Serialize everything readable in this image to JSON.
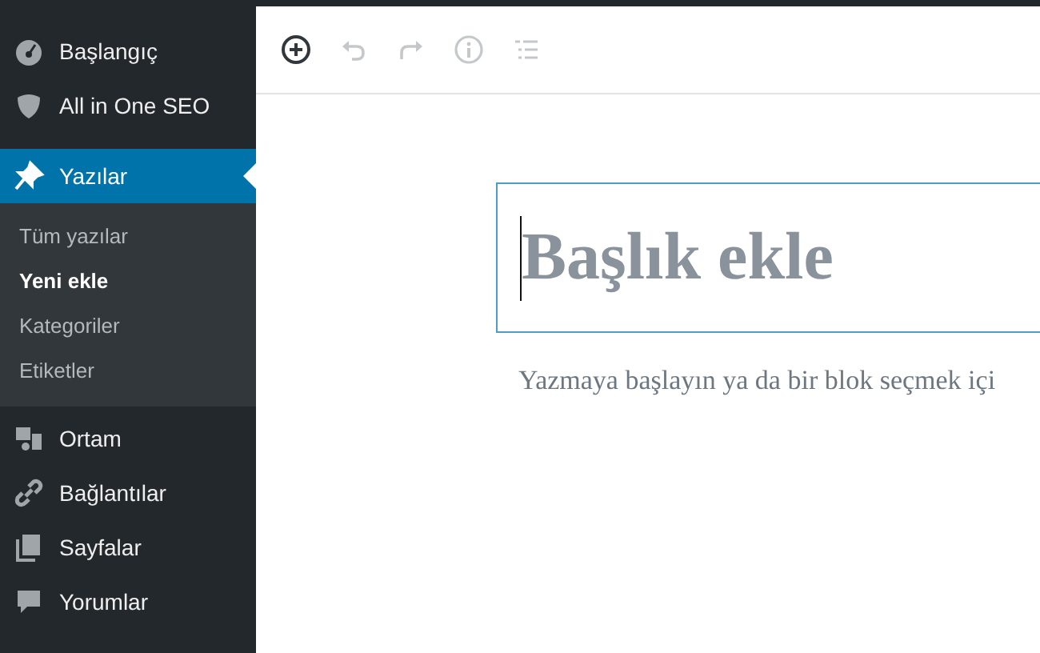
{
  "sidebar": {
    "items": [
      {
        "label": "Başlangıç",
        "kind": "dashboard",
        "selected": false
      },
      {
        "label": "All in One SEO",
        "kind": "shield",
        "selected": false
      },
      {
        "label": "Yazılar",
        "kind": "pin",
        "selected": true,
        "children": [
          {
            "label": "Tüm yazılar",
            "selected": false
          },
          {
            "label": "Yeni ekle",
            "selected": true
          },
          {
            "label": "Kategoriler",
            "selected": false
          },
          {
            "label": "Etiketler",
            "selected": false
          }
        ]
      },
      {
        "label": "Ortam",
        "kind": "media",
        "selected": false
      },
      {
        "label": "Bağlantılar",
        "kind": "link",
        "selected": false
      },
      {
        "label": "Sayfalar",
        "kind": "pages",
        "selected": false
      },
      {
        "label": "Yorumlar",
        "kind": "comment",
        "selected": false
      }
    ]
  },
  "toolbar": [
    {
      "kind": "add",
      "disabled": false
    },
    {
      "kind": "undo",
      "disabled": true
    },
    {
      "kind": "redo",
      "disabled": true
    },
    {
      "kind": "info",
      "disabled": true
    },
    {
      "kind": "outline",
      "disabled": true
    }
  ],
  "editor": {
    "title": {
      "placeholder": "Başlık ekle"
    },
    "body": {
      "placeholder": "Yazmaya başlayın ya da bir blok seçmek içi"
    }
  }
}
